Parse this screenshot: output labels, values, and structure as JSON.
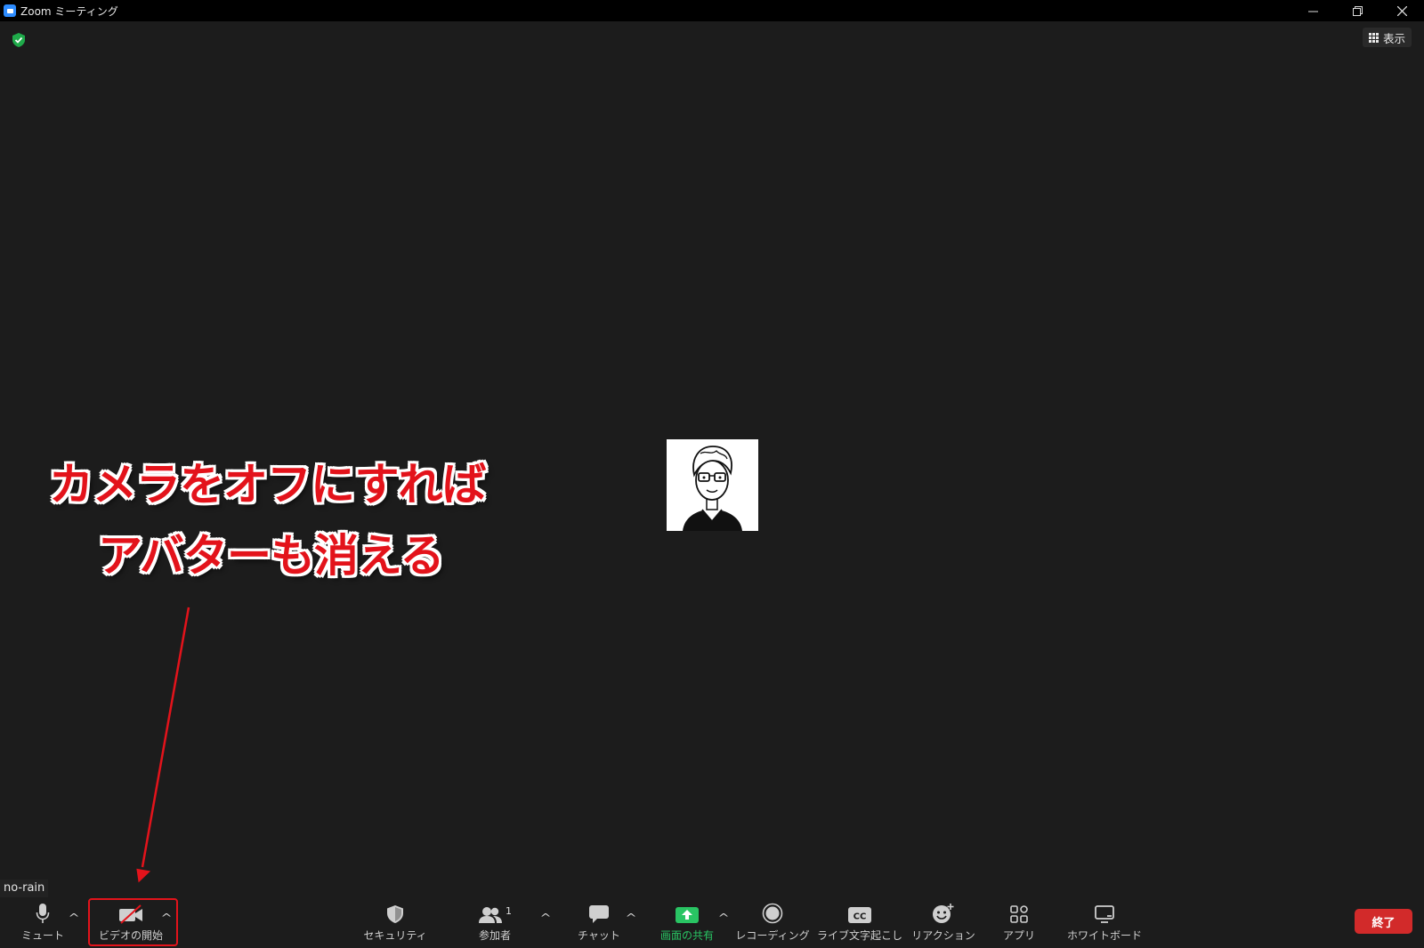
{
  "window": {
    "title": "Zoom ミーティング",
    "controls": {
      "minimize": "—",
      "restore": "❐",
      "close": "✕"
    }
  },
  "top": {
    "view_label": "表示"
  },
  "annotation": {
    "line1": "カメラをオフにすれば",
    "line2": "アバターも消える",
    "color": "#e3131b"
  },
  "participant": {
    "name": "no-rain"
  },
  "toolbar": {
    "mute_label": "ミュート",
    "video_label": "ビデオの開始",
    "security_label": "セキュリティ",
    "participants_label": "参加者",
    "participants_count": "1",
    "chat_label": "チャット",
    "share_label": "画面の共有",
    "record_label": "レコーディング",
    "captions_label": "ライブ文字起こし",
    "reactions_label": "リアクション",
    "apps_label": "アプリ",
    "whiteboard_label": "ホワイトボード",
    "end_label": "終了",
    "caret": "^"
  },
  "colors": {
    "background": "#1c1c1c",
    "share_green": "#29c463",
    "end_red": "#d22a2a",
    "zoom_blue": "#2d8cff"
  }
}
